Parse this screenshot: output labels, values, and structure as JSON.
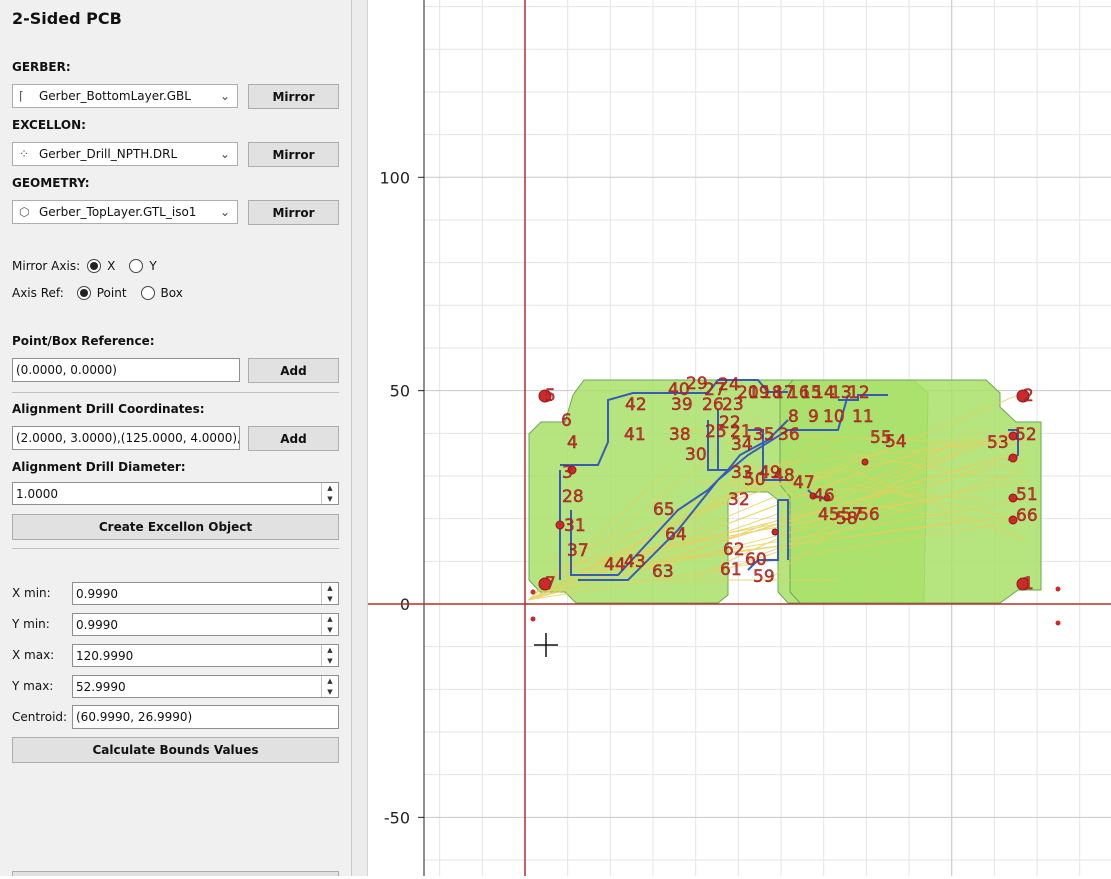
{
  "panel": {
    "title": "2-Sided PCB",
    "gerber": {
      "label": "GERBER:",
      "value": "Gerber_BottomLayer.GBL",
      "mirror": "Mirror"
    },
    "excellon": {
      "label": "EXCELLON:",
      "value": "Gerber_Drill_NPTH.DRL",
      "mirror": "Mirror"
    },
    "geometry": {
      "label": "GEOMETRY:",
      "value": "Gerber_TopLayer.GTL_iso1",
      "mirror": "Mirror"
    },
    "mirror_axis": {
      "label": "Mirror Axis:",
      "options": [
        "X",
        "Y"
      ],
      "selected": "X"
    },
    "axis_ref": {
      "label": "Axis Ref:",
      "options": [
        "Point",
        "Box"
      ],
      "selected": "Point"
    },
    "point_box_ref": {
      "label": "Point/Box Reference:",
      "value": "(0.0000, 0.0000)",
      "add": "Add"
    },
    "align_coords": {
      "label": "Alignment Drill Coordinates:",
      "value": "(2.0000, 3.0000),(125.0000, 4.0000),",
      "add": "Add"
    },
    "align_diameter": {
      "label": "Alignment Drill Diameter:",
      "value": "1.0000"
    },
    "create_excellon": "Create Excellon Object",
    "bounds": {
      "xmin": {
        "label": "X min:",
        "value": "0.9990"
      },
      "ymin": {
        "label": "Y min:",
        "value": "0.9990"
      },
      "xmax": {
        "label": "X max:",
        "value": "120.9990"
      },
      "ymax": {
        "label": "Y max:",
        "value": "52.9990"
      },
      "centroid": {
        "label": "Centroid:",
        "value": "(60.9990, 26.9990)"
      }
    },
    "calc_bounds": "Calculate Bounds Values"
  },
  "plot": {
    "y_ticks": [
      "100",
      "50",
      "0",
      "-50"
    ],
    "colors": {
      "axis": "#b03030",
      "copper_fill": "#a9e06a",
      "copper_edge": "#6aa84f",
      "trace": "#3a5bb5",
      "ratsnest": "#e3cf5a",
      "pad": "#cc2a2a",
      "grid": "#e4e4e4",
      "major_grid": "#c8c8c8"
    },
    "drill_labels": [
      "5",
      "2",
      "7",
      "1",
      "6",
      "4",
      "3",
      "28",
      "31",
      "37",
      "44",
      "43",
      "42",
      "41",
      "40",
      "39",
      "38",
      "30",
      "29",
      "27",
      "26",
      "25",
      "24",
      "23",
      "22",
      "21",
      "20",
      "19",
      "18",
      "17",
      "16",
      "15",
      "14",
      "13",
      "12",
      "11",
      "10",
      "9",
      "8",
      "36",
      "35",
      "34",
      "33",
      "32",
      "50",
      "49",
      "48",
      "47",
      "46",
      "45",
      "58",
      "57",
      "56",
      "55",
      "54",
      "53",
      "52",
      "51",
      "66",
      "65",
      "64",
      "63",
      "62",
      "61",
      "60",
      "59"
    ]
  }
}
